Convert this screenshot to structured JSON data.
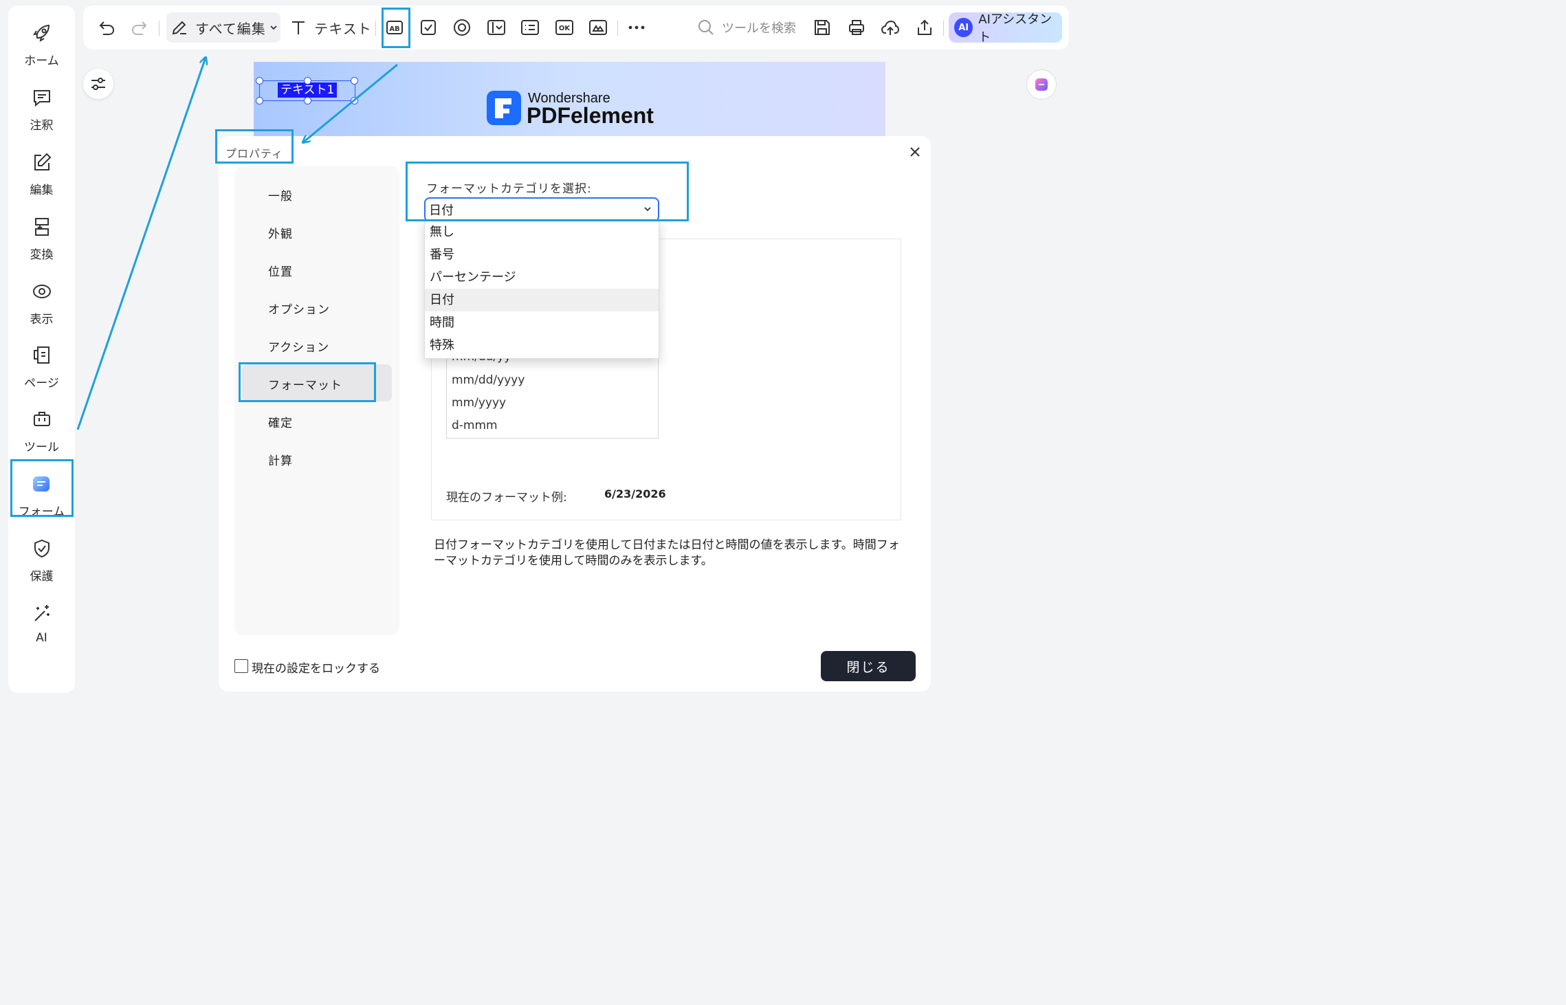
{
  "sidebar": {
    "items": [
      {
        "label": "ホーム",
        "icon": "rocket-icon"
      },
      {
        "label": "注釈",
        "icon": "comment-icon"
      },
      {
        "label": "編集",
        "icon": "edit-icon"
      },
      {
        "label": "変換",
        "icon": "convert-icon"
      },
      {
        "label": "表示",
        "icon": "eye-icon"
      },
      {
        "label": "ページ",
        "icon": "pages-icon"
      },
      {
        "label": "ツール",
        "icon": "toolbox-icon"
      },
      {
        "label": "フォーム",
        "icon": "form-icon"
      },
      {
        "label": "保護",
        "icon": "shield-icon"
      },
      {
        "label": "AI",
        "icon": "magic-wand-icon"
      }
    ]
  },
  "toolbar": {
    "edit_all_label": "すべて編集",
    "text_label": "テキスト",
    "search_placeholder": "ツールを検索",
    "ai_label": "AIアシスタント",
    "ai_badge": "AI"
  },
  "document": {
    "text_field_name": "テキスト1",
    "brand_small": "Wondershare",
    "brand_large": "PDFelement"
  },
  "dialog": {
    "title": "プロパティ",
    "tabs": [
      "一般",
      "外観",
      "位置",
      "オプション",
      "アクション",
      "フォーマット",
      "確定",
      "計算"
    ],
    "active_tab": "フォーマット",
    "category_label": "フォーマットカテゴリを選択:",
    "category_value": "日付",
    "category_options": [
      "無し",
      "番号",
      "パーセンテージ",
      "日付",
      "時間",
      "特殊"
    ],
    "date_formats_visible": [
      "mm/dd/yy",
      "mm/dd/yyyy",
      "mm/yyyy",
      "d-mmm"
    ],
    "example_label": "現在のフォーマット例:",
    "example_value": "6/23/2026",
    "description": "日付フォーマットカテゴリを使用して日付または日付と時間の値を表示します。時間フォーマットカテゴリを使用して時間のみを表示します。",
    "lock_label": "現在の設定をロックする",
    "close_label": "閉じる"
  },
  "colors": {
    "highlight": "#1ea0dd",
    "accent_blue": "#2f6dff",
    "close_button": "#1f2430"
  }
}
